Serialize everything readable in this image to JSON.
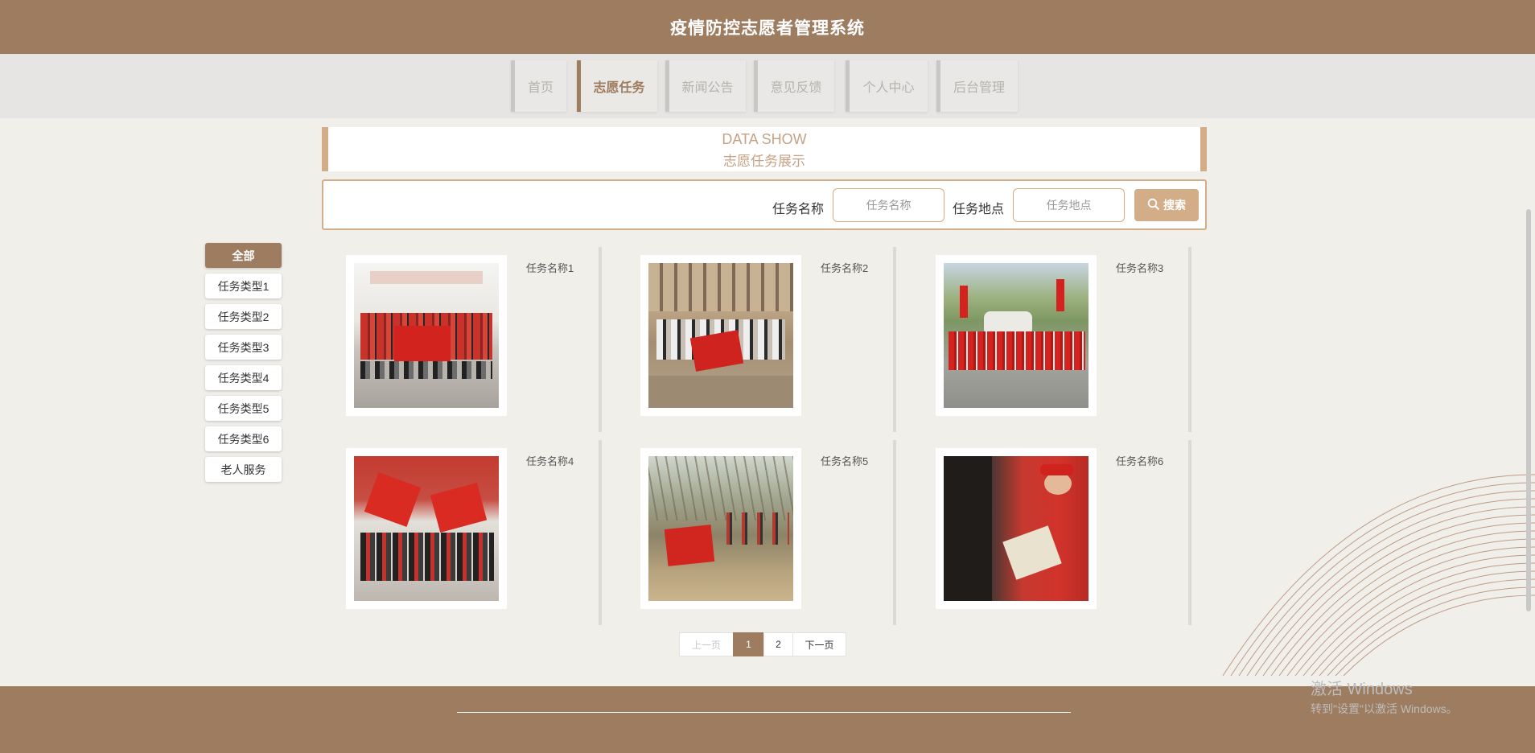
{
  "header": {
    "title": "疫情防控志愿者管理系统"
  },
  "nav": {
    "items": [
      {
        "label": "首页"
      },
      {
        "label": "志愿任务"
      },
      {
        "label": "新闻公告"
      },
      {
        "label": "意见反馈"
      },
      {
        "label": "个人中心"
      },
      {
        "label": "后台管理"
      }
    ],
    "active_index": 1
  },
  "banner": {
    "title_en": "DATA SHOW",
    "title_cn": "志愿任务展示"
  },
  "search": {
    "name_label": "任务名称",
    "name_placeholder": "任务名称",
    "location_label": "任务地点",
    "location_placeholder": "任务地点",
    "button_label": "搜索"
  },
  "categories": [
    {
      "label": "全部"
    },
    {
      "label": "任务类型1"
    },
    {
      "label": "任务类型2"
    },
    {
      "label": "任务类型3"
    },
    {
      "label": "任务类型4"
    },
    {
      "label": "任务类型5"
    },
    {
      "label": "任务类型6"
    },
    {
      "label": "老人服务"
    }
  ],
  "tasks": [
    {
      "title": "任务名称1",
      "photo_icon": "group-photo-icon"
    },
    {
      "title": "任务名称2",
      "photo_icon": "group-photo-icon"
    },
    {
      "title": "任务名称3",
      "photo_icon": "group-photo-icon"
    },
    {
      "title": "任务名称4",
      "photo_icon": "group-photo-icon"
    },
    {
      "title": "任务名称5",
      "photo_icon": "group-photo-icon"
    },
    {
      "title": "任务名称6",
      "photo_icon": "group-photo-icon"
    }
  ],
  "pagination": {
    "prev": "上一页",
    "pages": [
      "1",
      "2"
    ],
    "current": "1",
    "next": "下一页"
  },
  "system_watermark": {
    "line1": "激活 Windows",
    "line2": "转到\"设置\"以激活 Windows。"
  },
  "colors": {
    "brand": "#9d7c5f",
    "accent": "#d3ad88",
    "background": "#f1efea"
  }
}
